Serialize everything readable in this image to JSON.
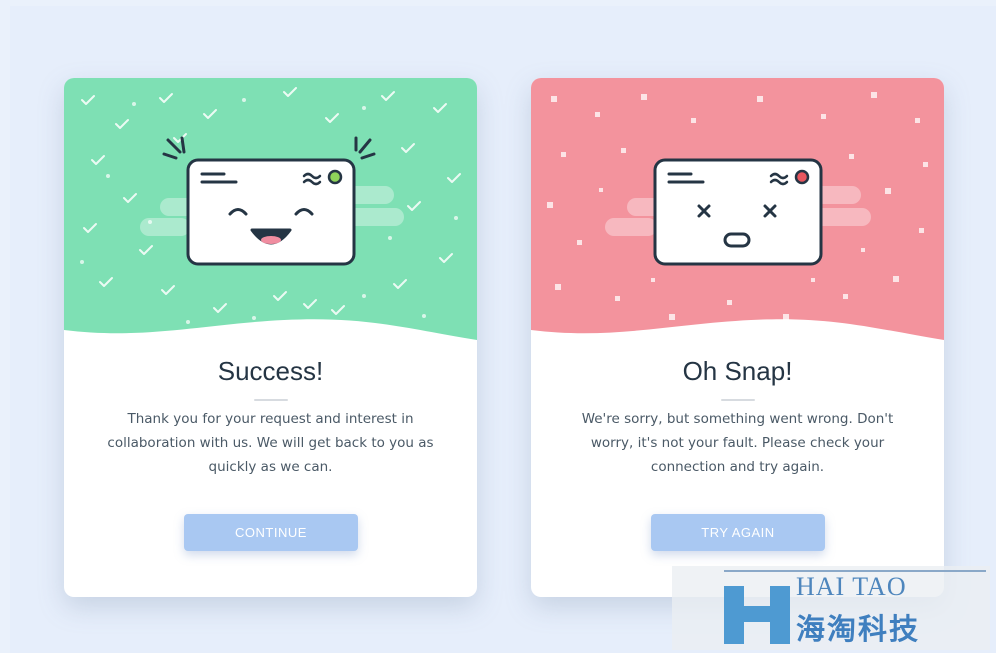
{
  "cards": [
    {
      "id": "success",
      "title": "Success!",
      "message": "Thank you for your request and interest in collaboration with us. We will get back to you as quickly as we can.",
      "button_label": "CONTINUE",
      "hero_color": "#7ee0b4",
      "status_dot_color": "#8fd35a",
      "face": "happy"
    },
    {
      "id": "error",
      "title": "Oh Snap!",
      "message": "We're sorry, but something went wrong. Don't worry, it's not your fault. Please check your connection and try again.",
      "button_label": "TRY AGAIN",
      "hero_color": "#f3939d",
      "status_dot_color": "#e8575f",
      "face": "dizzy"
    }
  ],
  "watermark": {
    "latin": "HAI TAO",
    "cjk": "海淘科技"
  },
  "colors": {
    "background": "#e6eefb",
    "button": "#a9c8f2",
    "title": "#253544",
    "text": "#4a5966"
  }
}
